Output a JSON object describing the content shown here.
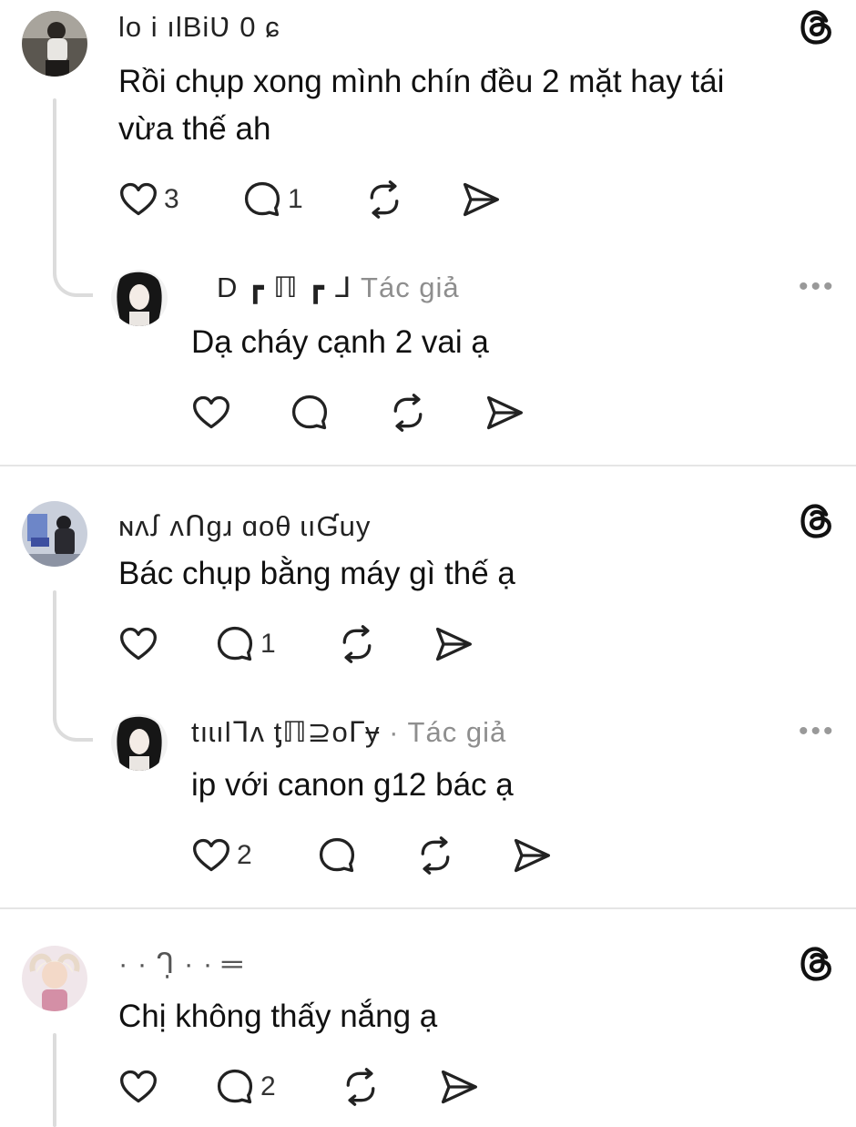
{
  "threads": [
    {
      "comment": {
        "username": "lo i ılBiƲ 0 ɕ",
        "text_line1": "Rồi chụp xong mình chín đều 2 mặt hay tái",
        "text_line2": "vừa thế ah",
        "likes": "3",
        "replies": "1"
      },
      "reply": {
        "username": "D ┏   ℿ ┏ ᒧ",
        "author_tag": "Tác giả",
        "text": "Dạ cháy cạnh 2 vai ạ",
        "likes": "",
        "replies": ""
      }
    },
    {
      "comment": {
        "username": "ɴʌꭍ ʌՈɡɹ ɑoθ ɩıƓuy",
        "text_line1": "Bác chụp bằng máy gì thế ạ",
        "likes": "",
        "replies": "1"
      },
      "reply": {
        "username": "tıɩılᒣʌ ƫℿ⊇oᒥɏ",
        "author_tag": "· Tác giả",
        "text": "ip với canon g12 bác ạ",
        "likes": "2",
        "replies": ""
      }
    },
    {
      "comment": {
        "username": "·    ·  ᒉ̣   · ·  ═",
        "text_line1": "Chị không thấy nắng ạ",
        "likes": "",
        "replies": "2"
      }
    }
  ],
  "icons": {
    "like": "heart-icon",
    "reply": "comment-bubble-icon",
    "repost": "repost-icon",
    "share": "send-icon",
    "more": "more-dots-icon",
    "brand": "threads-logo-icon"
  },
  "more_label": "•••"
}
